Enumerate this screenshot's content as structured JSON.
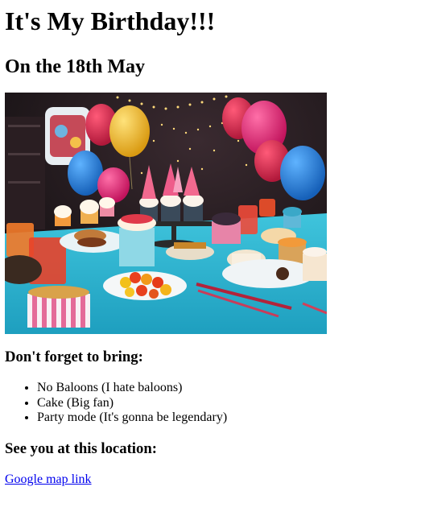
{
  "page": {
    "title": "It's My Birthday!!!",
    "date_heading": "On the 18th May",
    "bring_heading": "Don't forget to bring:",
    "bring_items": [
      "No Baloons (I hate baloons)",
      "Cake (Big fan)",
      "Party mode (It's gonna be legendary)"
    ],
    "location_heading": "See you at this location:",
    "map_link": "Google map link"
  },
  "colors": {
    "link": "#0000ee",
    "tablecloth": "#29b5cf",
    "backdrop": "#1e1418"
  }
}
